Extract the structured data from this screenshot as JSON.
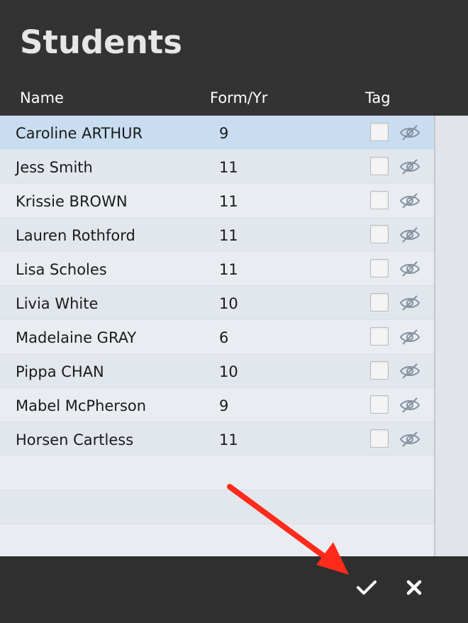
{
  "dialog": {
    "title": "Students"
  },
  "columns": {
    "name": "Name",
    "form": "Form/Yr",
    "tag": "Tag"
  },
  "students": [
    {
      "name": "Caroline ARTHUR",
      "form": "9",
      "selected": true
    },
    {
      "name": "Jess Smith",
      "form": "11"
    },
    {
      "name": "Krissie BROWN",
      "form": "11"
    },
    {
      "name": "Lauren Rothford",
      "form": "11"
    },
    {
      "name": "Lisa Scholes",
      "form": "11"
    },
    {
      "name": "Livia White",
      "form": "10"
    },
    {
      "name": "Madelaine GRAY",
      "form": "6"
    },
    {
      "name": "Pippa CHAN",
      "form": "10"
    },
    {
      "name": "Mabel McPherson",
      "form": "9"
    },
    {
      "name": "Horsen Cartless",
      "form": "11"
    }
  ],
  "icons": {
    "tag": "checkbox",
    "visibility": "eye-slash-icon",
    "confirm": "checkmark-icon",
    "cancel": "close-icon",
    "annotation": "red-arrow"
  },
  "colors": {
    "header_bg": "#333333",
    "selected_row": "#c9ddf0",
    "annotation_arrow": "#ff2a1a"
  }
}
